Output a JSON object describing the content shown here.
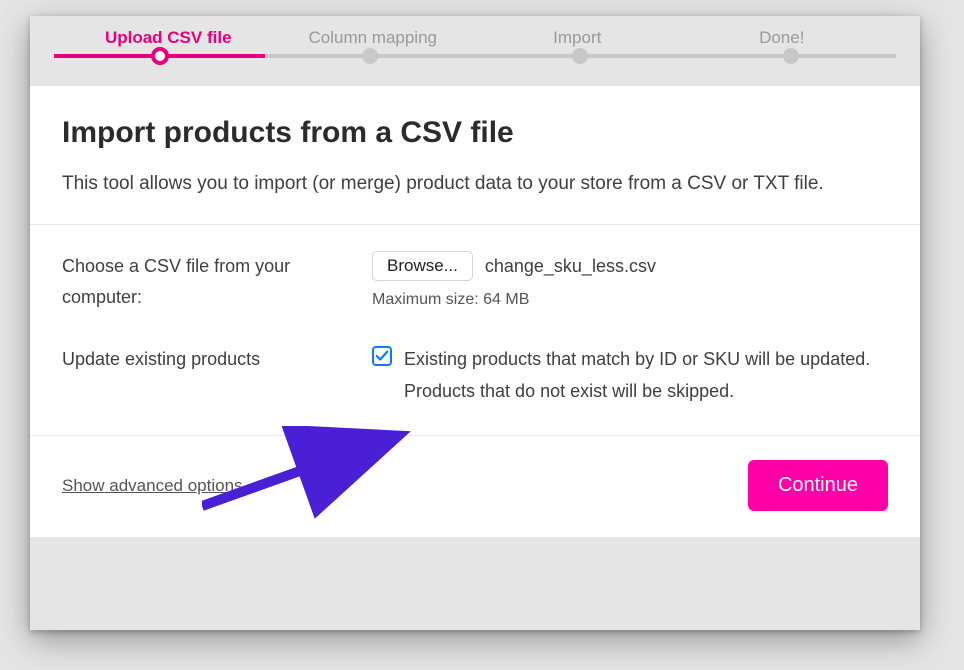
{
  "stepper": {
    "steps": [
      "Upload CSV file",
      "Column mapping",
      "Import",
      "Done!"
    ],
    "activeIndex": 0
  },
  "panel": {
    "title": "Import products from a CSV file",
    "description": "This tool allows you to import (or merge) product data to your store from a CSV or TXT file."
  },
  "file": {
    "label": "Choose a CSV file from your computer:",
    "browse": "Browse...",
    "filename": "change_sku_less.csv",
    "hint": "Maximum size: 64 MB"
  },
  "update": {
    "label": "Update existing products",
    "checked": true,
    "description": "Existing products that match by ID or SKU will be updated. Products that do not exist will be skipped."
  },
  "footer": {
    "advanced": "Show advanced options",
    "continue": "Continue"
  },
  "colors": {
    "accent": "#e6007e",
    "primaryButton": "#ff00a8",
    "checkbox": "#0a7aff",
    "arrow": "#4b1fd6"
  }
}
